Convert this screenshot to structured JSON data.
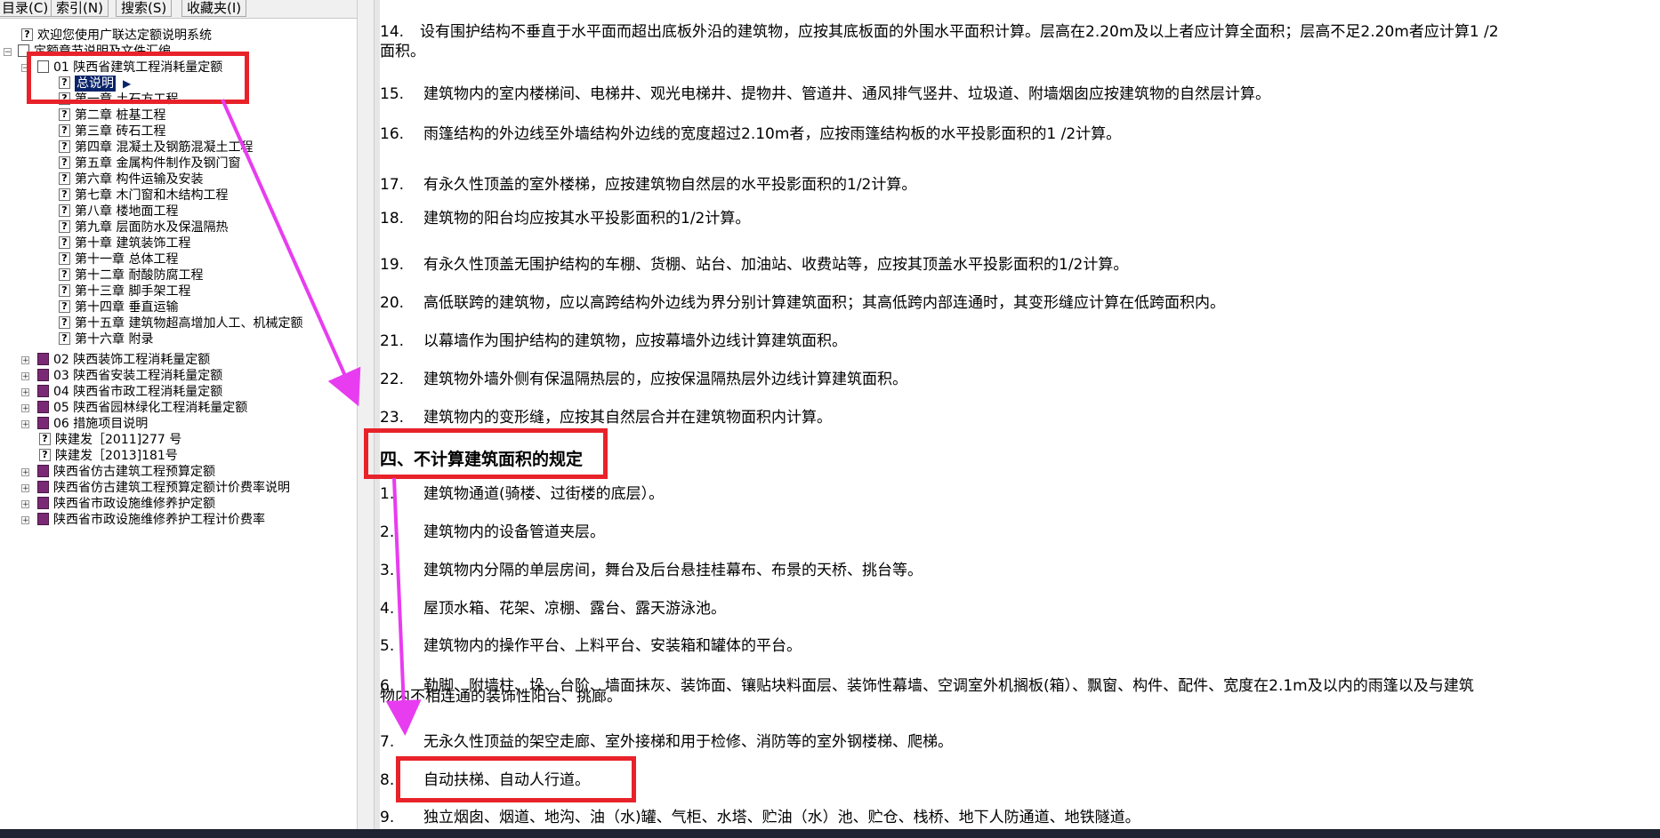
{
  "tabs": [
    "目录(C)",
    "索引(N)",
    "搜索(S)",
    "收藏夹(I)"
  ],
  "tree": {
    "welcome": "欢迎您使用广联达定额说明系统",
    "root": "定额章节说明及文件汇编",
    "book01": "01 陕西省建筑工程消耗量定额",
    "selected": "总说明",
    "chapters": [
      "第一章 土石方工程",
      "第二章 桩基工程",
      "第三章 砖石工程",
      "第四章 混凝土及钢筋混凝土工程",
      "第五章 金属构件制作及钢门窗",
      "第六章 构件运输及安装",
      "第七章 木门窗和木结构工程",
      "第八章 楼地面工程",
      "第九章 层面防水及保温隔热",
      "第十章 建筑装饰工程",
      "第十一章 总体工程",
      "第十二章 耐酸防腐工程",
      "第十三章 脚手架工程",
      "第十四章 垂直运输",
      "第十五章 建筑物超高增加人工、机械定额",
      "第十六章 附录"
    ],
    "books": [
      "02 陕西装饰工程消耗量定额",
      "03 陕西省安装工程消耗量定额",
      "04 陕西省市政工程消耗量定额",
      "05 陕西省园林绿化工程消耗量定额",
      "06 措施项目说明"
    ],
    "docs": [
      "陕建发［2011]277 号",
      "陕建发［2013]181号"
    ],
    "others": [
      "陕西省仿古建筑工程预算定额",
      "陕西省仿古建筑工程预算定额计价费率说明",
      "陕西省市政设施维修养护定额",
      "陕西省市政设施维修养护工程计价费率"
    ]
  },
  "content": {
    "p14_num": "14.",
    "p14_text": "设有围护结构不垂直于水平面而超出底板外沿的建筑物，应按其底板面的外围水平面积计算。层高在2.20m及以上者应计算全面积；层高不足2.20m者应计算1 /2",
    "p14_cont": "面积。",
    "items": [
      {
        "num": "15.",
        "text": "建筑物内的室内楼梯间、电梯井、观光电梯井、提物井、管道井、通风排气竖井、垃圾道、附墙烟囱应按建筑物的自然层计算。"
      },
      {
        "num": "16.",
        "text": "雨篷结构的外边线至外墙结构外边线的宽度超过2.10m者，应按雨篷结构板的水平投影面积的1 /2计算。"
      },
      {
        "num": "17.",
        "text": "有永久性顶盖的室外楼梯，应按建筑物自然层的水平投影面积的1/2计算。"
      },
      {
        "num": "18.",
        "text": "建筑物的阳台均应按其水平投影面积的1/2计算。"
      },
      {
        "num": "19.",
        "text": "有永久性顶盖无围护结构的车棚、货棚、站台、加油站、收费站等，应按其顶盖水平投影面积的1/2计算。"
      },
      {
        "num": "20.",
        "text": "高低联跨的建筑物，应以高跨结构外边线为界分别计算建筑面积；其高低跨内部连通时，其变形缝应计算在低跨面积内。"
      },
      {
        "num": "21.",
        "text": "以幕墙作为围护结构的建筑物，应按幕墙外边线计算建筑面积。"
      },
      {
        "num": "22.",
        "text": "建筑物外墙外侧有保温隔热层的，应按保温隔热层外边线计算建筑面积。"
      },
      {
        "num": "23.",
        "text": "建筑物内的变形缝，应按其自然层合并在建筑物面积内计算。"
      }
    ],
    "heading": "四、不计算建筑面积的规定",
    "rules": [
      {
        "num": "1.",
        "text": "建筑物通道(骑楼、过街楼的底层）。"
      },
      {
        "num": "2.",
        "text": "建筑物内的设备管道夹层。"
      },
      {
        "num": "3.",
        "text": "建筑物内分隔的单层房间，舞台及后台悬挂桂幕布、布景的天桥、挑台等。"
      },
      {
        "num": "4.",
        "text": "屋顶水箱、花架、凉棚、露台、露天游泳池。"
      },
      {
        "num": "5.",
        "text": "建筑物内的操作平台、上料平台、安装箱和罐体的平台。"
      },
      {
        "num": "6.",
        "text": "勒脚、附墙柱、垛、台阶、墙面抹灰、装饰面、镶贴块料面层、装饰性幕墙、空调室外机搁板(箱）、飘窗、构件、配件、宽度在2.1m及以内的雨篷以及与建筑"
      },
      {
        "num": "7.",
        "text": "无永久性顶益的架空走廊、室外接梯和用于检修、消防等的室外钢楼梯、爬梯。"
      },
      {
        "num": "8.",
        "text": "自动扶梯、自动人行道。"
      },
      {
        "num": "9.",
        "text": "独立烟囱、烟道、地沟、油（水)罐、气柜、水塔、贮油（水）池、贮仓、栈桥、地下人防通道、地铁隧道。"
      }
    ],
    "rule6_cont": "物内不相连通的装饰性阳台、挑廊。"
  },
  "colors": {
    "annotation_box": "#e8222a",
    "annotation_arrow": "#e83cf0",
    "selection": "#0a246a"
  }
}
